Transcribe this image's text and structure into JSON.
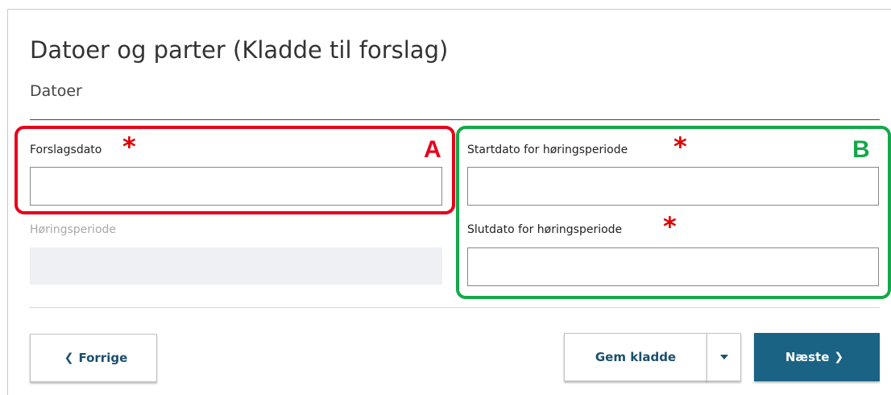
{
  "page": {
    "title": "Datoer og parter (Kladde til forslag)",
    "section": "Datoer"
  },
  "fields": {
    "forslagsdato": {
      "label": "Forslagsdato",
      "value": "",
      "required_mark": "*"
    },
    "horingsperiode": {
      "label": "Høringsperiode",
      "value": ""
    },
    "startdato": {
      "label": "Startdato for høringsperiode",
      "value": "",
      "required_mark": "*"
    },
    "slutdato": {
      "label": "Slutdato for høringsperiode",
      "value": "",
      "required_mark": "*"
    }
  },
  "annotations": {
    "a": {
      "letter": "A",
      "color": "#e8001c"
    },
    "b": {
      "letter": "B",
      "color": "#15a84a"
    }
  },
  "buttons": {
    "previous": {
      "label": "Forrige",
      "icon": "chevron-left-icon"
    },
    "save_draft": {
      "label": "Gem kladde"
    },
    "save_dropdown": {
      "icon": "caret-down-icon"
    },
    "next": {
      "label": "Næste",
      "icon": "chevron-right-icon"
    }
  },
  "colors": {
    "primary": "#1a6384",
    "required": "#e00000",
    "link_text": "#1b4f6e"
  }
}
